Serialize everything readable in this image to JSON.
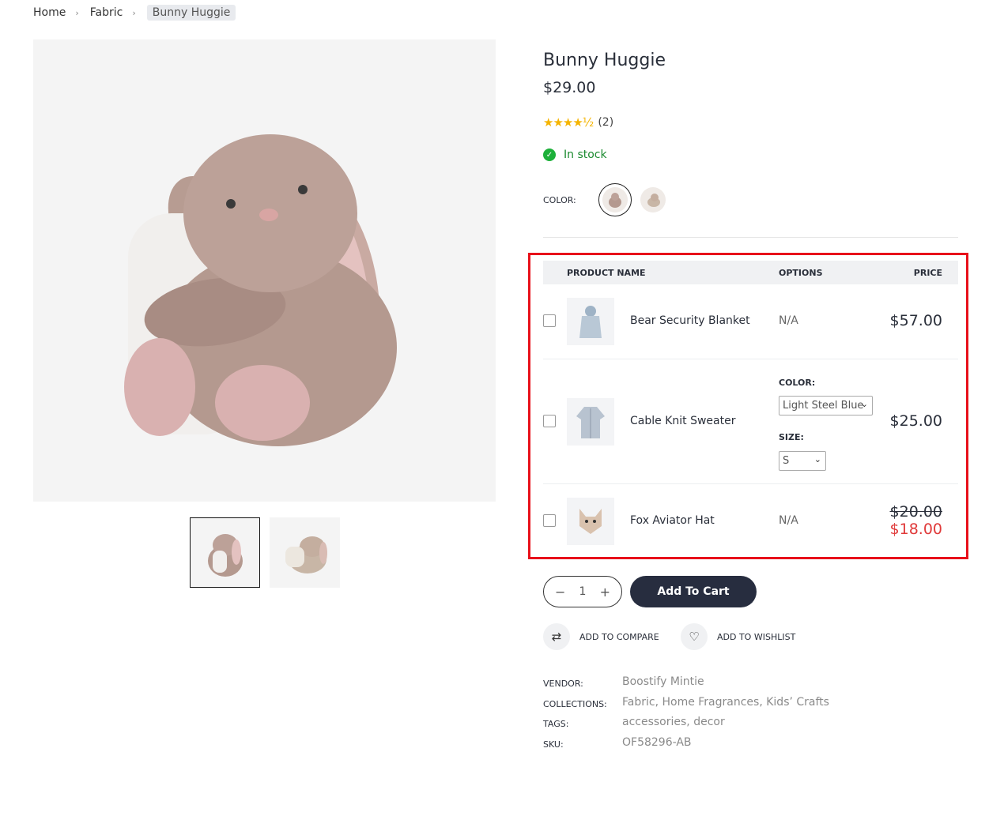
{
  "breadcrumb": {
    "home": "Home",
    "category": "Fabric",
    "current": "Bunny Huggie"
  },
  "product": {
    "title": "Bunny Huggie",
    "price": "$29.00",
    "rating_value": 4.5,
    "stars": "★★★★½",
    "review_count": "(2)",
    "stock": "In stock",
    "color_label": "COLOR:"
  },
  "bundle": {
    "headers": {
      "name": "PRODUCT NAME",
      "options": "OPTIONS",
      "price": "PRICE"
    },
    "items": [
      {
        "name": "Bear Security Blanket",
        "options": "N/A",
        "price": "$57.00"
      },
      {
        "name": "Cable Knit Sweater",
        "color_label": "COLOR:",
        "color_value": "Light Steel Blue",
        "size_label": "SIZE:",
        "size_value": "S",
        "price": "$25.00"
      },
      {
        "name": "Fox Aviator Hat",
        "options": "N/A",
        "old_price": "$20.00",
        "price": "$18.00"
      }
    ]
  },
  "cart": {
    "qty": "1",
    "minus": "−",
    "plus": "+",
    "add_label": "Add To Cart"
  },
  "actions": {
    "compare": "ADD TO COMPARE",
    "wishlist": "ADD TO WISHLIST"
  },
  "meta": {
    "vendor_label": "VENDOR:",
    "vendor": "Boostify Mintie",
    "collections_label": "COLLECTIONS:",
    "collections": "Fabric, Home Fragrances, Kids’ Crafts",
    "tags_label": "TAGS:",
    "tags": "accessories, decor",
    "sku_label": "SKU:",
    "sku": "OF58296-AB"
  },
  "colors": {
    "accent": "#272d3f",
    "sale": "#e03a3a",
    "stock": "#1b8a2f",
    "highlight": "#e8101a",
    "star": "#f5b400"
  }
}
